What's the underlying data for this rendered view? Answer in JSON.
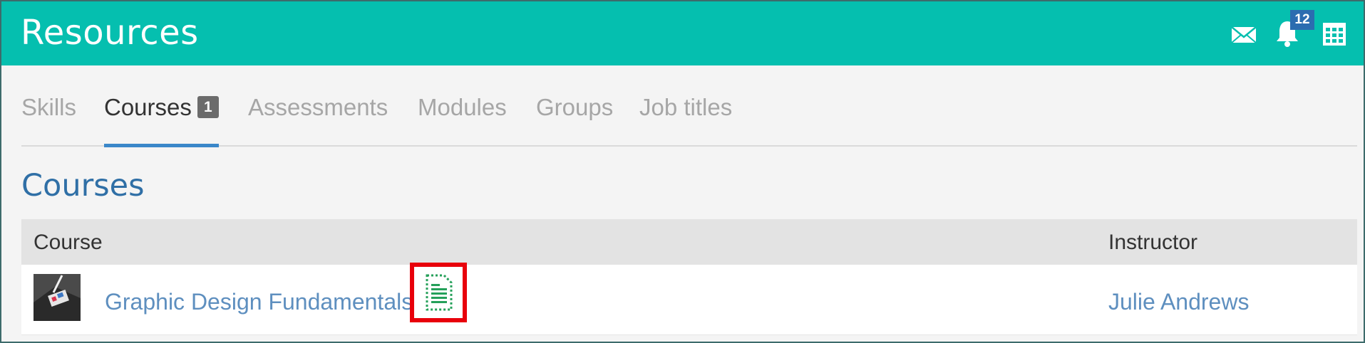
{
  "header": {
    "title": "Resources",
    "notification_count": "12",
    "icons": [
      "mail-icon",
      "bell-icon",
      "calendar-icon"
    ]
  },
  "tabs": [
    {
      "label": "Skills"
    },
    {
      "label": "Courses",
      "count": "1",
      "active": true
    },
    {
      "label": "Assessments"
    },
    {
      "label": "Modules"
    },
    {
      "label": "Groups"
    },
    {
      "label": "Job titles"
    }
  ],
  "section": {
    "title": "Courses"
  },
  "table": {
    "headers": [
      "Course",
      "Instructor"
    ],
    "rows": [
      {
        "course": "Graphic Design Fundamentals",
        "instructor": "Julie Andrews",
        "icon": "document-icon"
      }
    ]
  },
  "colors": {
    "header": "#05bfaf",
    "link": "#5e8fbf",
    "highlight": "#e8000b",
    "active_tab": "#3a87c9"
  }
}
